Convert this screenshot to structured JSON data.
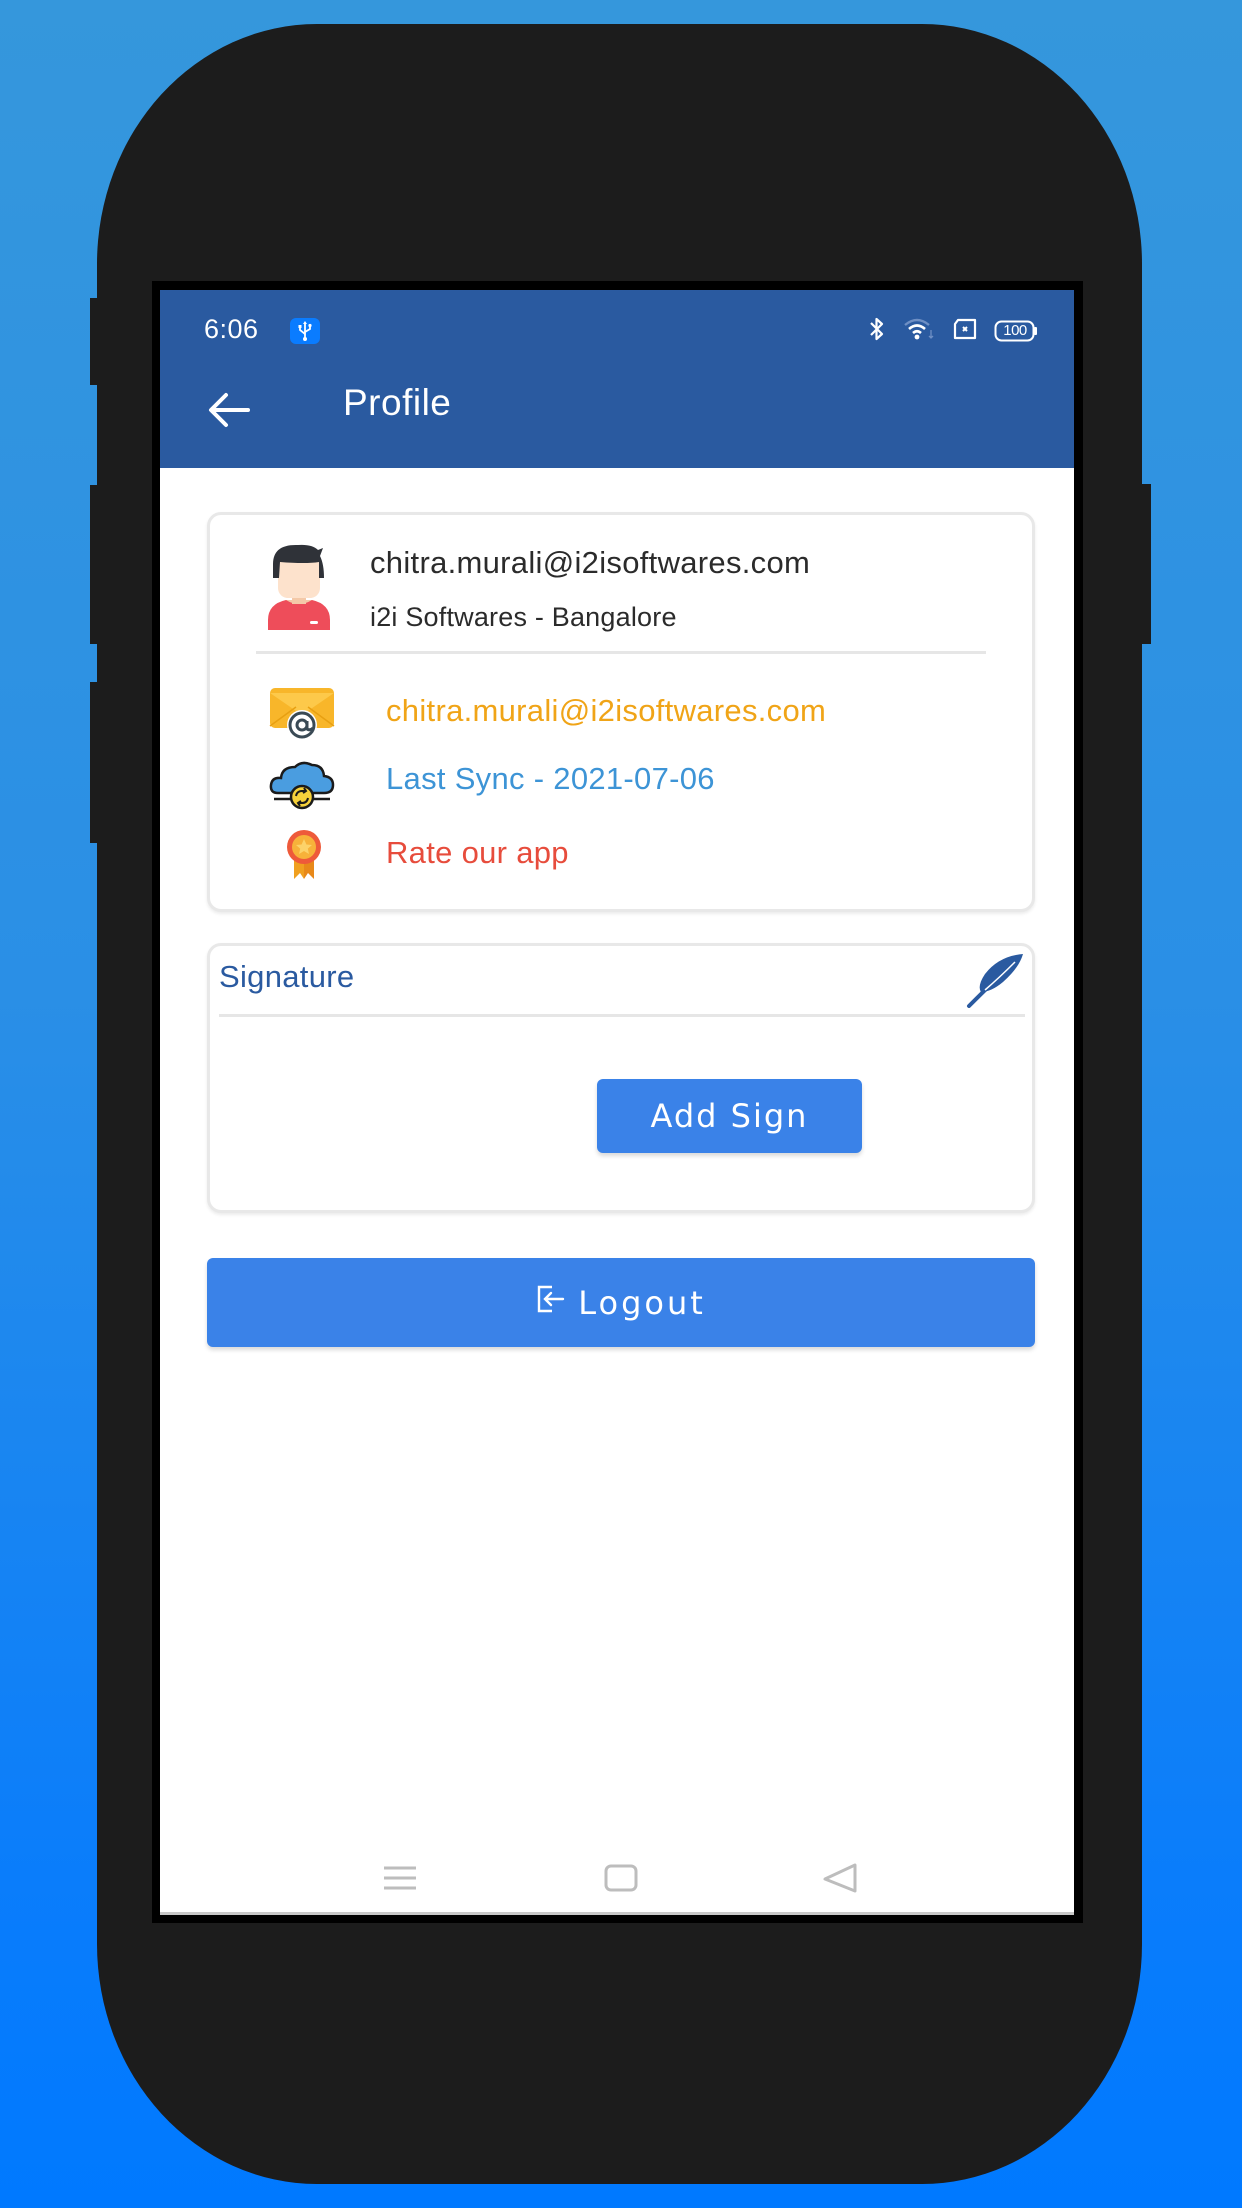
{
  "status_bar": {
    "time": "6:06",
    "usb_icon": "usb-icon",
    "icons": [
      "bluetooth-icon",
      "wifi-icon",
      "sim-icon",
      "battery-icon"
    ],
    "battery_level": "100"
  },
  "app_bar": {
    "back_icon": "arrow-left-icon",
    "title": "Profile"
  },
  "profile": {
    "avatar_icon": "user-avatar-icon",
    "email": "chitra.murali@i2isoftwares.com",
    "company": "i2i Softwares - Bangalore",
    "items": [
      {
        "icon": "mail-at-icon",
        "label": "chitra.murali@i2isoftwares.com",
        "color": "#f0a417"
      },
      {
        "icon": "cloud-sync-icon",
        "label": "Last Sync - 2021-07-06",
        "color": "#3d94d6"
      },
      {
        "icon": "award-badge-icon",
        "label": "Rate our app",
        "color": "#e74c3c"
      }
    ]
  },
  "signature": {
    "title": "Signature",
    "edit_icon": "feather-pen-icon",
    "add_button": "Add Sign"
  },
  "logout": {
    "icon": "logout-icon",
    "label": "Logout"
  },
  "nav_bar": {
    "icons": [
      "menu-icon",
      "home-icon",
      "back-icon"
    ]
  },
  "colors": {
    "primary": "#2a5aa0",
    "button": "#3a82e8",
    "signature_title": "#2a5aa0"
  }
}
